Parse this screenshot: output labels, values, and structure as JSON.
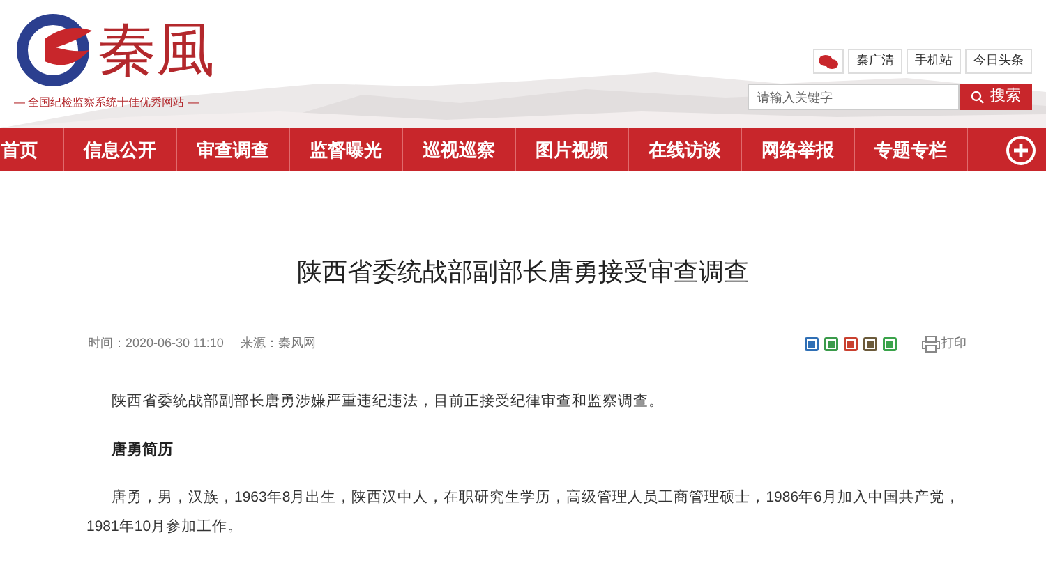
{
  "header": {
    "logo_text": "秦風",
    "tagline": "— 全国纪检监察系统十佳优秀网站 —",
    "links": [
      {
        "kind": "icon"
      },
      {
        "kind": "text",
        "label": "秦广清"
      },
      {
        "kind": "text",
        "label": "手机站"
      },
      {
        "kind": "text",
        "label": "今日头条"
      }
    ],
    "search": {
      "placeholder": "请输入关键字",
      "button": "搜索"
    }
  },
  "nav": {
    "items": [
      {
        "label": "首页"
      },
      {
        "label": "信息公开"
      },
      {
        "label": "审查调查"
      },
      {
        "label": "监督曝光"
      },
      {
        "label": "巡视巡察"
      },
      {
        "label": "图片视频"
      },
      {
        "label": "在线访谈"
      },
      {
        "label": "网络举报"
      },
      {
        "label": "专题专栏"
      }
    ]
  },
  "article": {
    "title": "陕西省委统战部副部长唐勇接受审查调查",
    "time": "时间：2020-06-30 11:10",
    "source": "来源：秦风网",
    "print": "打印",
    "paragraphs": [
      {
        "kind": "text",
        "text": "陕西省委统战部副部长唐勇涉嫌严重违纪违法，目前正接受纪律审查和监察调查。"
      },
      {
        "kind": "heading",
        "text": "唐勇简历"
      },
      {
        "kind": "text",
        "text": "唐勇，男，汉族，1963年8月出生，陕西汉中人，在职研究生学历，高级管理人员工商管理硕士，1986年6月加入中国共产党，1981年10月参加工作。"
      }
    ]
  }
}
